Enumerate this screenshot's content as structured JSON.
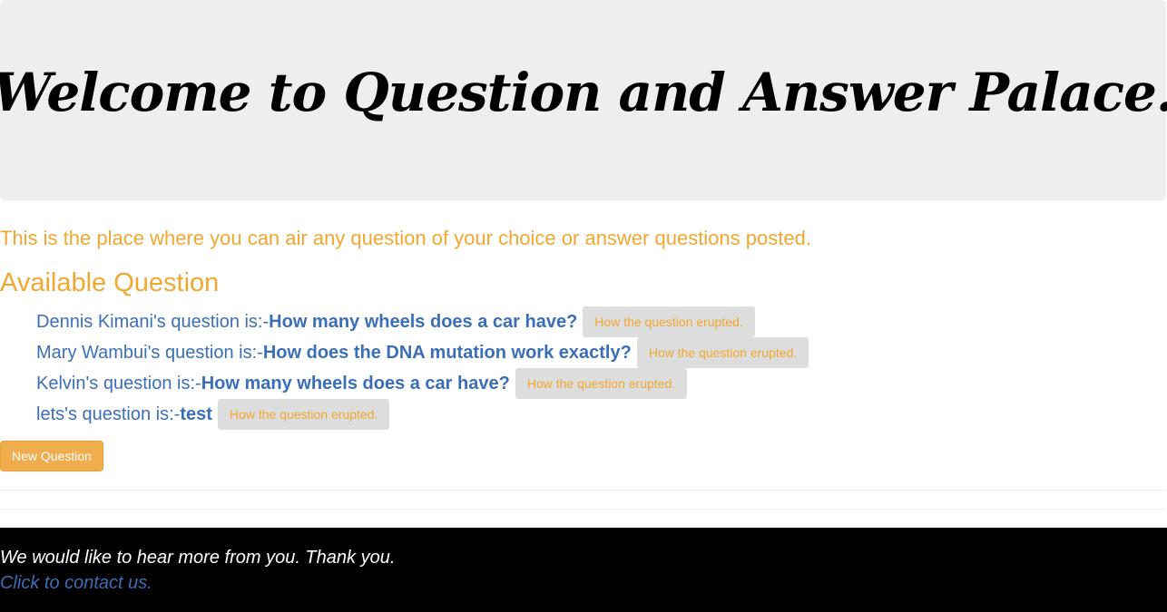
{
  "header": {
    "title": "Welcome to Question and Answer Palace."
  },
  "intro": {
    "text": "This is the place where you can air any question of your choice or answer questions posted."
  },
  "questions": {
    "heading": "Available Question",
    "items": [
      {
        "author_label": "Dennis Kimani's question is:-",
        "question": "How many wheels does a car have?",
        "button_label": "How the question erupted."
      },
      {
        "author_label": "Mary Wambui's question is:-",
        "question": "How does the DNA mutation work exactly?",
        "button_label": "How the question erupted."
      },
      {
        "author_label": "Kelvin's question is:-",
        "question": "How many wheels does a car have?",
        "button_label": "How the question erupted."
      },
      {
        "author_label": "lets's question is:-",
        "question": "test",
        "button_label": "How the question erupted."
      }
    ],
    "new_question_label": "New Question"
  },
  "footer": {
    "message": "We would like to hear more from you. Thank you.",
    "contact_link": "Click to contact us."
  },
  "colors": {
    "accent_orange": "#f0a830",
    "link_blue": "#3a6fb8",
    "jumbotron_bg": "#eeeeee",
    "footer_bg": "#000000"
  }
}
